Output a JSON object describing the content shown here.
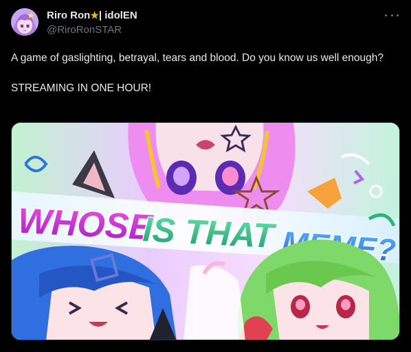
{
  "tweet": {
    "display_name": "Riro Ron",
    "name_suffix": "| idolEN",
    "handle": "@RiroRonSTAR",
    "text_line1": "A game of gaslighting, betrayal, tears and blood. Do you know us well enough?",
    "text_line2": "STREAMING IN ONE HOUR!"
  },
  "media": {
    "title_word1": "WHOSE",
    "title_word2": "IS THAT",
    "title_word3": "MEME?"
  },
  "colors": {
    "background": "#000000",
    "text": "#e7e9ea",
    "muted": "#71767b",
    "star": "#f4b400"
  },
  "icons": {
    "more": "more-horizontal-icon",
    "star": "star-icon"
  }
}
